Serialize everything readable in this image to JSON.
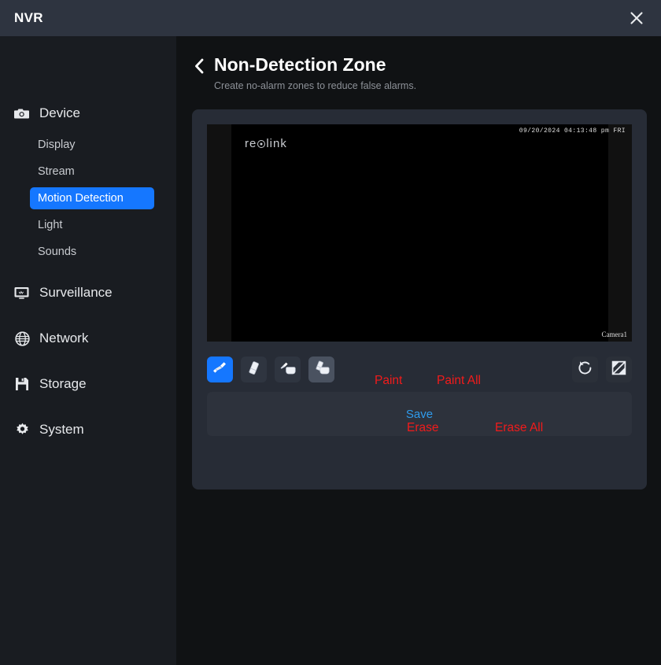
{
  "window": {
    "title": "NVR",
    "close_icon": "close-icon"
  },
  "sidebar": {
    "groups": [
      {
        "icon": "camera-icon",
        "label": "Device",
        "items": [
          {
            "label": "Display",
            "active": false
          },
          {
            "label": "Stream",
            "active": false
          },
          {
            "label": "Motion Detection",
            "active": true
          },
          {
            "label": "Light",
            "active": false
          },
          {
            "label": "Sounds",
            "active": false
          }
        ]
      },
      {
        "icon": "monitor-icon",
        "label": "Surveillance",
        "items": []
      },
      {
        "icon": "globe-icon",
        "label": "Network",
        "items": []
      },
      {
        "icon": "floppy-disk-icon",
        "label": "Storage",
        "items": []
      },
      {
        "icon": "gear-icon",
        "label": "System",
        "items": []
      }
    ]
  },
  "page": {
    "back_icon": "chevron-left-icon",
    "title": "Non-Detection Zone",
    "subtitle": "Create no-alarm zones to reduce false alarms."
  },
  "video": {
    "logo": "reolink",
    "timestamp": "09/20/2024 04:13:48 pm FRI",
    "camera_label": "Camera1"
  },
  "toolbar": {
    "tools": [
      {
        "name": "paint-brush-tool",
        "icon": "paint-brush-icon",
        "state": "active"
      },
      {
        "name": "eraser-tool",
        "icon": "eraser-icon",
        "state": "normal"
      },
      {
        "name": "paint-all-tool",
        "icon": "paint-bucket-brush-icon",
        "state": "normal"
      },
      {
        "name": "erase-all-tool",
        "icon": "paint-bucket-eraser-icon",
        "state": "hover"
      }
    ],
    "right_tools": [
      {
        "name": "reset-button",
        "icon": "reset-circular-arrow-icon"
      },
      {
        "name": "fullscreen-button",
        "icon": "fullscreen-expand-icon"
      }
    ]
  },
  "save": {
    "label": "Save"
  },
  "annotations": {
    "paint": "Paint",
    "paint_all": "Paint All",
    "erase": "Erase",
    "erase_all": "Erase All"
  },
  "colors": {
    "accent": "#1577ff",
    "titlebar": "#2e3440",
    "sidebar": "#191c21",
    "content": "#101214",
    "card": "#272c36",
    "annotation": "#f21b1b",
    "save_link": "#2f9bec"
  }
}
